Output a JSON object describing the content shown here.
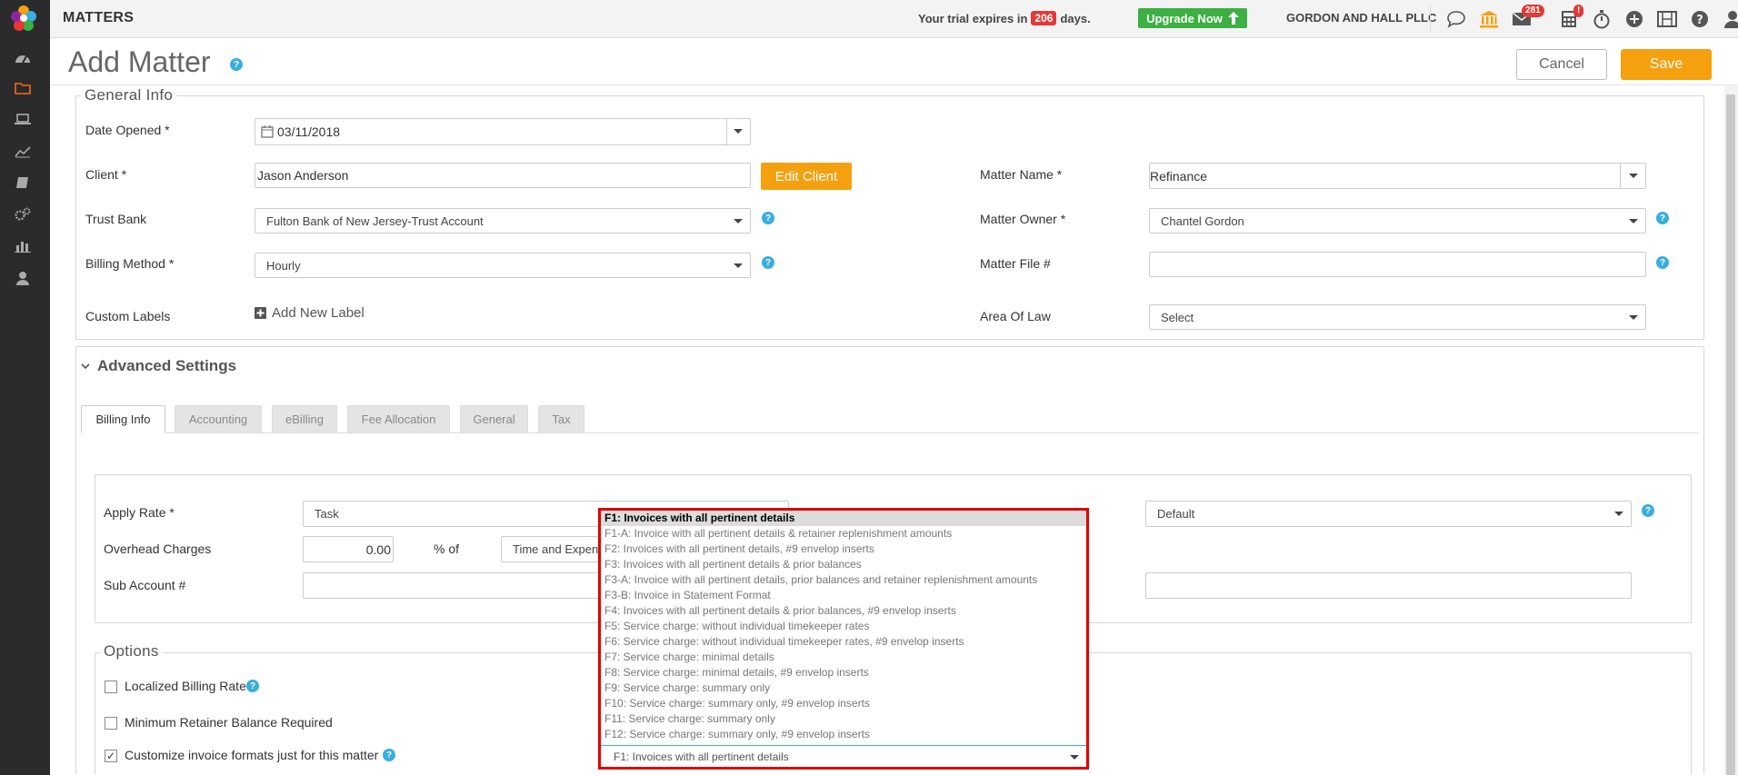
{
  "topbar": {
    "app_title": "MATTERS",
    "trial_prefix": "Your trial expires in",
    "trial_days": "206",
    "trial_suffix": "days.",
    "upgrade_label": "Upgrade Now",
    "firm_name": "GORDON AND HALL PLLC",
    "mail_count": "281",
    "calendar_alert": "!"
  },
  "page": {
    "title": "Add Matter",
    "cancel_label": "Cancel",
    "save_label": "Save"
  },
  "general_info": {
    "legend": "General Info",
    "date_opened_label": "Date Opened *",
    "date_opened_value": "03/11/2018",
    "client_label": "Client *",
    "client_value": "Jason Anderson",
    "edit_client_label": "Edit Client",
    "trust_bank_label": "Trust Bank",
    "trust_bank_value": "Fulton Bank of New Jersey-Trust Account",
    "billing_method_label": "Billing Method *",
    "billing_method_value": "Hourly",
    "custom_labels_label": "Custom Labels",
    "add_label": "Add New Label",
    "matter_name_label": "Matter Name *",
    "matter_name_value": "Refinance",
    "matter_owner_label": "Matter Owner *",
    "matter_owner_value": "Chantel Gordon",
    "matter_file_label": "Matter File #",
    "matter_file_value": "",
    "area_of_law_label": "Area Of Law",
    "area_of_law_value": "Select"
  },
  "advanced": {
    "title": "Advanced Settings",
    "tabs": [
      "Billing Info",
      "Accounting",
      "eBilling",
      "Fee Allocation",
      "General",
      "Tax"
    ],
    "apply_rate_label": "Apply Rate *",
    "apply_rate_value": "Task",
    "overhead_label": "Overhead Charges",
    "overhead_value": "0.00",
    "percent_of_label": "% of",
    "overhead_base_value": "Time and Expens",
    "sub_account_label": "Sub Account #",
    "right_select_value": "Default"
  },
  "options": {
    "legend": "Options",
    "localized_rate_label": "Localized Billing Rate",
    "min_retainer_label": "Minimum Retainer Balance Required",
    "customize_invoice_label": "Customize invoice formats just for this matter",
    "customize_checked": "✓"
  },
  "invoice_dropdown": {
    "items": [
      "F1: Invoices with all pertinent details",
      "F1-A: Invoice with all pertinent details & retainer replenishment amounts",
      "F2: Invoices with all pertinent details, #9 envelop inserts",
      "F3: Invoices with all pertinent details & prior balances",
      "F3-A: Invoice with all pertinent details, prior balances and retainer replenishment amounts",
      "F3-B: Invoice in Statement Format",
      "F4: Invoices with all pertinent details & prior balances, #9 envelop inserts",
      "F5: Service charge: without individual timekeeper rates",
      "F6: Service charge: without individual timekeeper rates, #9 envelop inserts",
      "F7: Service charge: minimal details",
      "F8: Service charge: minimal details, #9 envelop inserts",
      "F9: Service charge: summary only",
      "F10: Service charge: summary only, #9 envelop inserts",
      "F11: Service charge: summary only",
      "F12: Service charge: summary only, #9 envelop inserts"
    ],
    "selected_value": "F1: Invoices with all pertinent details"
  },
  "colors": {
    "accent_orange": "#f5a00f",
    "upgrade_green": "#3cb043",
    "badge_red": "#e53935",
    "help_blue": "#3aaee0",
    "sidebar_dark": "#2b2b2b",
    "highlight_red": "#e00000"
  }
}
